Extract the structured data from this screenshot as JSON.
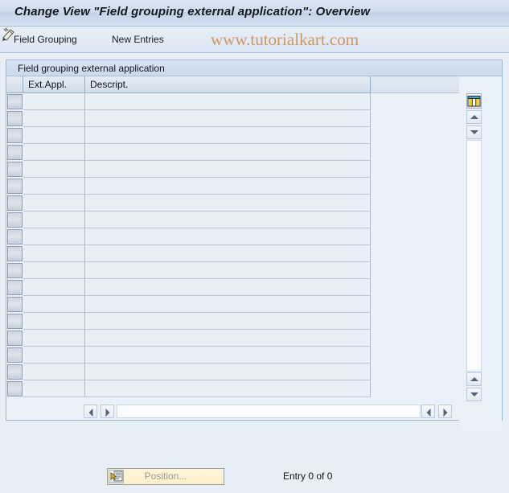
{
  "window": {
    "title": "Change View \"Field grouping external application\": Overview"
  },
  "toolbar": {
    "field_grouping_label": "Field Grouping",
    "new_entries_label": "New Entries",
    "icons": [
      {
        "name": "change-pencil-icon",
        "title": "Display/Change"
      },
      {
        "name": "copy-as-icon",
        "title": "Copy As..."
      },
      {
        "name": "delete-row-icon",
        "title": "Delete"
      },
      {
        "name": "undo-icon",
        "title": "Undo Change"
      },
      {
        "name": "select-all-icon",
        "title": "Select All"
      },
      {
        "name": "deselect-all-icon",
        "title": "Deselect All"
      },
      {
        "name": "details-icon",
        "title": "Details"
      }
    ]
  },
  "watermark": {
    "text": "www.tutorialkart.com",
    "color": "#c8752a"
  },
  "panel": {
    "caption": "Field grouping external application"
  },
  "table": {
    "columns": [
      {
        "key": "sel",
        "label": ""
      },
      {
        "key": "ext_appl",
        "label": "Ext.Appl."
      },
      {
        "key": "descript",
        "label": "Descript."
      }
    ],
    "rows": [],
    "empty_row_count": 18,
    "config_icon": "table-settings-icon"
  },
  "scrollbars": {
    "vertical": {
      "up_icon": "scroll-up-icon",
      "down_icon": "scroll-down-icon"
    },
    "horizontal": {
      "left_icon": "scroll-left-icon",
      "right_icon": "scroll-right-icon"
    }
  },
  "footer": {
    "position_button_label": "Position...",
    "position_button_icon": "position-icon",
    "position_button_enabled": false,
    "entry_count_text": "Entry 0 of 0"
  },
  "colors": {
    "title_bar": "#cfdcee",
    "panel_border": "#9fb8d2",
    "cell_background": "#e9eff7",
    "page_background": "#e8eef6",
    "button_yellow": "#fbf0c8"
  }
}
